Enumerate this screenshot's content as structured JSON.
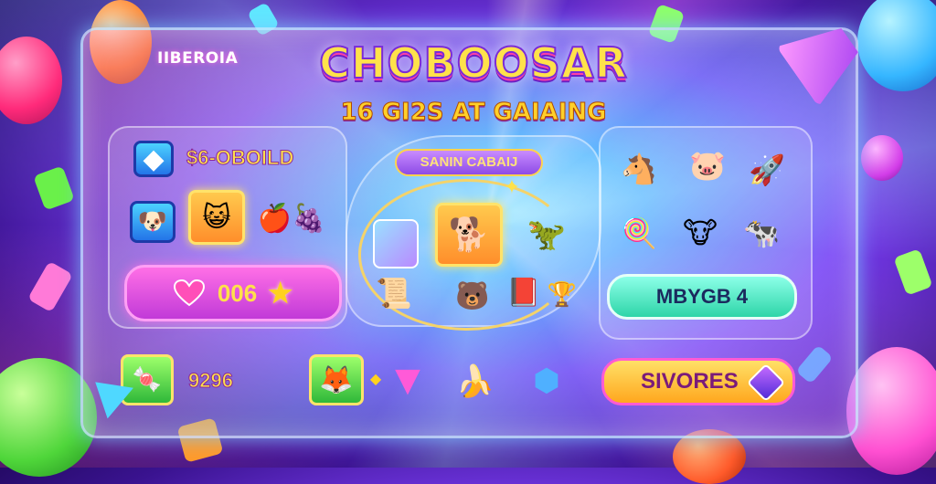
{
  "header": {
    "brand": "IIBEROIA",
    "title": "CHOBOOSAR",
    "subtitle": "16 GI2S AT GAIAING",
    "tag": "SANIN CABAIJ"
  },
  "left_panel": {
    "stat_top": "$6-OBOILD",
    "hearts_value": "006",
    "stat_bottom": "9296"
  },
  "right_panel": {
    "green_button_label": "MBYGB",
    "green_button_count": "4",
    "scores_label": "SIVORES"
  },
  "icons": {
    "left_tile_1": "gem",
    "left_tile_2": "cat",
    "left_tile_3": "puppy",
    "fruits": "fruit-basket",
    "bottom_left_tile": "candy",
    "bottom_tile": "fox",
    "mid_tile": "dog",
    "right_animals": [
      "horse",
      "pig",
      "rocket",
      "candy",
      "cow",
      "cow"
    ]
  },
  "colors": {
    "title_fill": "#ffe24a",
    "hearts_pill": "#e04fe3",
    "green_pill": "#3fdcb4",
    "scores_pill": "#ffc13a",
    "frame_border": "#c8e6ff"
  }
}
